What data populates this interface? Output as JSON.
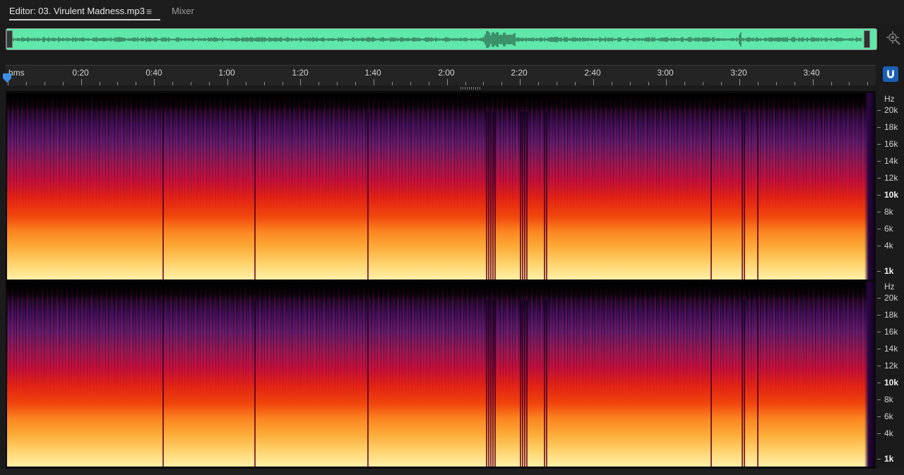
{
  "tabs": {
    "editor_label": "Editor: 03. Virulent Madness.mp3",
    "menu_icon": "≡",
    "mixer_label": "Mixer"
  },
  "overview": {
    "waveform_color": "#5fe8a9",
    "zoom_icon": "zoom-navigator-icon"
  },
  "ruler": {
    "labels": [
      "hms",
      "0:20",
      "0:40",
      "1:00",
      "1:20",
      "1:40",
      "2:00",
      "2:20",
      "2:40",
      "3:00",
      "3:20",
      "3:40"
    ],
    "snap_icon": "snap-magnet-icon",
    "accent": "#1b5fb6"
  },
  "spectral": {
    "colormap": [
      "#050105",
      "#3b0f56",
      "#9a1752",
      "#e32215",
      "#fb8420",
      "#fed571",
      "#fff0a8"
    ],
    "hz_labels": [
      "Hz",
      "20k",
      "18k",
      "16k",
      "14k",
      "12k",
      "10k",
      "8k",
      "6k",
      "4k",
      "1k"
    ],
    "hz_bold": "10k"
  }
}
